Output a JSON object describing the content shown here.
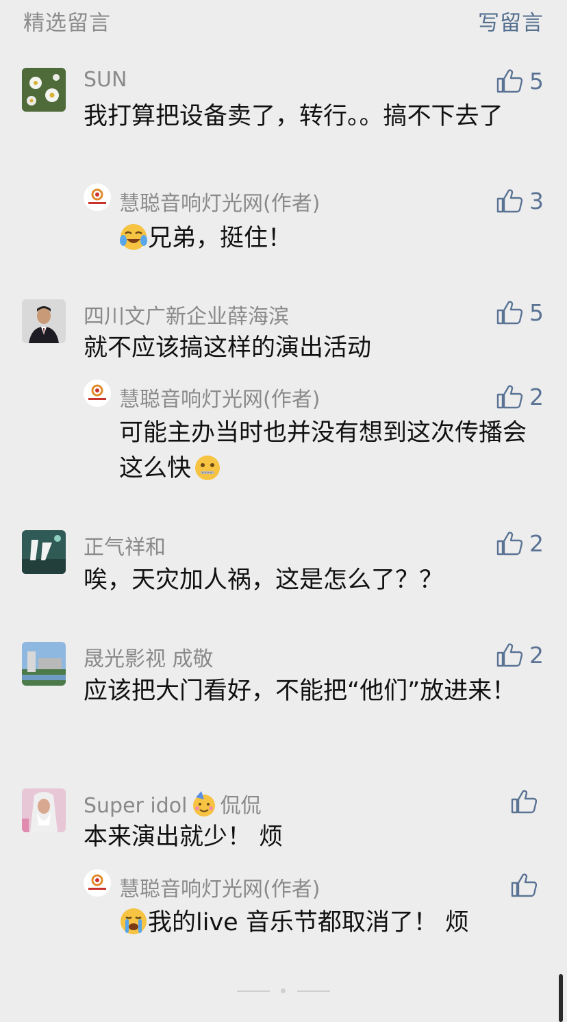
{
  "header": {
    "title": "精选留言",
    "write": "写留言"
  },
  "comments": [
    {
      "name": "SUN",
      "likes": "5",
      "text": "我打算把设备卖了，转行。。搞不下去了",
      "reply": {
        "name": "慧聪音响灯光网(作者)",
        "likes": "3",
        "text": "兄弟，挺住！",
        "emoji": "crying-laugh-emoji"
      }
    },
    {
      "name": "四川文广新企业薛海滨",
      "likes": "5",
      "text": "就不应该搞这样的演出活动",
      "reply": {
        "name": "慧聪音响灯光网(作者)",
        "likes": "2",
        "text": "可能主办当时也并没有想到这次传播会这么快",
        "emoji": "zipper-mouth-emoji"
      }
    },
    {
      "name": "正气祥和",
      "likes": "2",
      "text": "唉，天灾加人祸，这是怎么了？？"
    },
    {
      "name": "晟光影视 成敬",
      "likes": "2",
      "text": "应该把大门看好，不能把“他们”放进来！"
    },
    {
      "name_prefix": "Super idol",
      "name_suffix": "侃侃",
      "name_emoji": "party-face-emoji",
      "likes": "",
      "text": "本来演出就少！ 烦",
      "reply": {
        "name": "慧聪音响灯光网(作者)",
        "likes": "",
        "text": "我的live 音乐节都取消了！ 烦",
        "emoji": "crying-face-emoji"
      }
    }
  ],
  "colors": {
    "background": "#ededed",
    "link": "#55708f",
    "like": "#5a7394",
    "name": "#8a8a8a"
  }
}
